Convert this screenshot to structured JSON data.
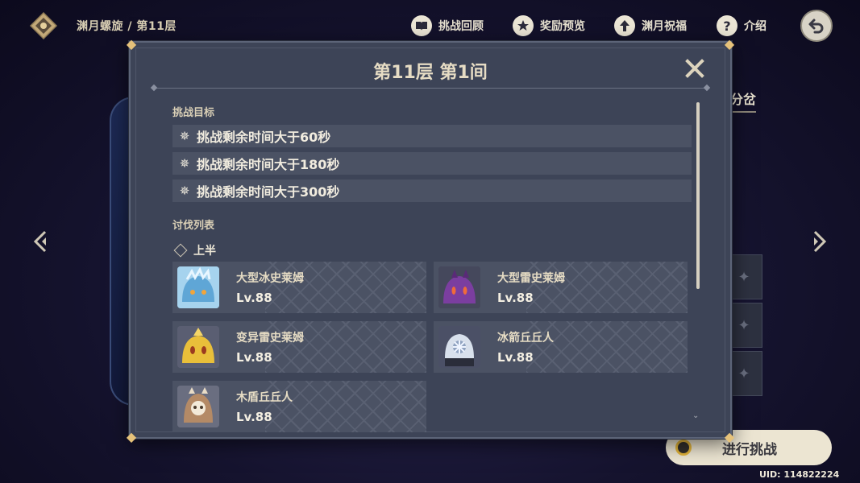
{
  "header": {
    "breadcrumb": "渊月螺旋 / 第11层",
    "nav": [
      {
        "label": "挑战回顾",
        "icon": "book-icon"
      },
      {
        "label": "奖励预览",
        "icon": "star-badge-icon"
      },
      {
        "label": "渊月祝福",
        "icon": "upgrade-arrow-icon"
      },
      {
        "label": "介绍",
        "icon": "help-icon"
      }
    ]
  },
  "background": {
    "tab_label": "分岔",
    "start_button": "进行挑战",
    "uid": "UID: 114822224"
  },
  "dialog": {
    "title": "第11层 第1间",
    "goals_label": "挑战目标",
    "goals": [
      "挑战剩余时间大于60秒",
      "挑战剩余时间大于180秒",
      "挑战剩余时间大于300秒"
    ],
    "enemies_label": "讨伐列表",
    "half_label": "上半",
    "enemies": [
      {
        "name": "大型冰史莱姆",
        "level": "Lv.88",
        "icon": "cryo-slime-icon",
        "color": "#7fb7dc"
      },
      {
        "name": "大型雷史莱姆",
        "level": "Lv.88",
        "icon": "electro-slime-icon",
        "color": "#7a3d98"
      },
      {
        "name": "变异雷史莱姆",
        "level": "Lv.88",
        "icon": "mutant-slime-icon",
        "color": "#e2b83a"
      },
      {
        "name": "冰箭丘丘人",
        "level": "Lv.88",
        "icon": "cryo-hilichurl-icon",
        "color": "#b8c3d6"
      },
      {
        "name": "木盾丘丘人",
        "level": "Lv.88",
        "icon": "wooden-shield-hilichurl-icon",
        "color": "#a07a5c"
      }
    ]
  }
}
